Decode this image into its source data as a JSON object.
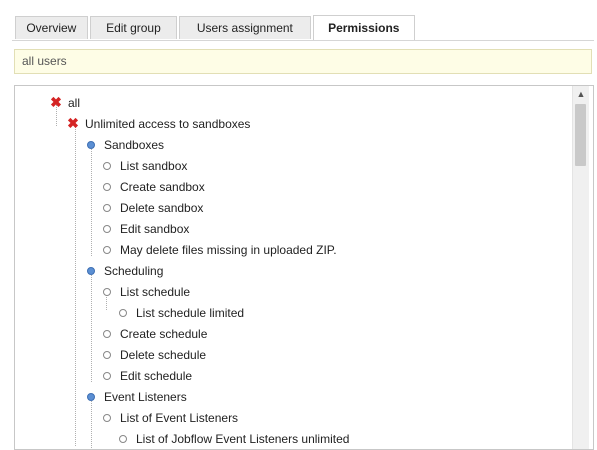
{
  "tabs": [
    {
      "label": "Overview"
    },
    {
      "label": "Edit group"
    },
    {
      "label": "Users assignment"
    },
    {
      "label": "Permissions"
    }
  ],
  "group_name": "all users",
  "tree": [
    {
      "label": "all",
      "icon": "red-x-icon"
    },
    {
      "label": "Unlimited access to sandboxes",
      "icon": "red-x-icon"
    },
    {
      "label": "Sandboxes",
      "icon": "blue-dot-icon"
    },
    {
      "label": "List sandbox",
      "icon": "circle-icon"
    },
    {
      "label": "Create sandbox",
      "icon": "circle-icon"
    },
    {
      "label": "Delete sandbox",
      "icon": "circle-icon"
    },
    {
      "label": "Edit sandbox",
      "icon": "circle-icon"
    },
    {
      "label": "May delete files missing in uploaded ZIP.",
      "icon": "circle-icon"
    },
    {
      "label": "Scheduling",
      "icon": "blue-dot-icon"
    },
    {
      "label": "List schedule",
      "icon": "circle-icon"
    },
    {
      "label": "List schedule limited",
      "icon": "circle-icon"
    },
    {
      "label": "Create schedule",
      "icon": "circle-icon"
    },
    {
      "label": "Delete schedule",
      "icon": "circle-icon"
    },
    {
      "label": "Edit schedule",
      "icon": "circle-icon"
    },
    {
      "label": "Event Listeners",
      "icon": "blue-dot-icon"
    },
    {
      "label": "List of Event Listeners",
      "icon": "circle-icon"
    },
    {
      "label": "List of Jobflow Event Listeners unlimited",
      "icon": "circle-icon"
    }
  ],
  "colors": {
    "accent": "#5b8fd3",
    "deny": "#d42424",
    "group_bg": "#fefde6"
  }
}
